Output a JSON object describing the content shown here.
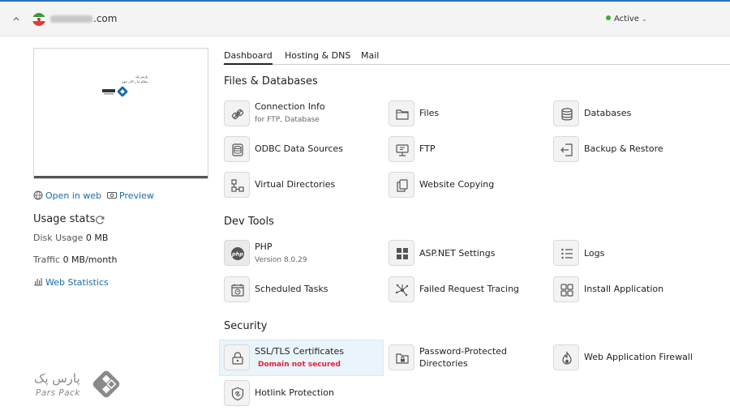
{
  "header": {
    "domain_suffix": ".com",
    "status": "Active",
    "status_color": "#3aab3a"
  },
  "preview": {
    "open_in_web": "Open in web",
    "preview": "Preview"
  },
  "usage": {
    "title": "Usage stats",
    "disk_label": "Disk Usage",
    "disk_value": "0 MB",
    "traffic_label": "Traffic",
    "traffic_value": "0 MB/month",
    "web_statistics": "Web Statistics"
  },
  "tabs": [
    "Dashboard",
    "Hosting & DNS",
    "Mail"
  ],
  "sections": {
    "files": {
      "title": "Files & Databases",
      "items": [
        {
          "label": "Connection Info",
          "sub": "for FTP, Database",
          "icon": "connection-icon"
        },
        {
          "label": "Files",
          "icon": "folder-icon"
        },
        {
          "label": "Databases",
          "icon": "database-icon"
        },
        {
          "label": "ODBC Data Sources",
          "icon": "odbc-icon"
        },
        {
          "label": "FTP",
          "icon": "ftp-icon"
        },
        {
          "label": "Backup & Restore",
          "icon": "backup-icon"
        },
        {
          "label": "Virtual Directories",
          "icon": "virtual-directories-icon"
        },
        {
          "label": "Website Copying",
          "icon": "copy-icon"
        }
      ]
    },
    "dev": {
      "title": "Dev Tools",
      "items": [
        {
          "label": "PHP",
          "sub": "Version 8.0.29",
          "icon": "php-icon"
        },
        {
          "label": "ASP.NET Settings",
          "icon": "aspnet-icon"
        },
        {
          "label": "Logs",
          "icon": "logs-icon"
        },
        {
          "label": "Scheduled Tasks",
          "icon": "scheduled-tasks-icon"
        },
        {
          "label": "Failed Request Tracing",
          "icon": "tracing-icon"
        },
        {
          "label": "Install Application",
          "icon": "install-app-icon"
        }
      ]
    },
    "security": {
      "title": "Security",
      "items": [
        {
          "label": "SSL/TLS Certificates",
          "warn": "Domain not secured",
          "icon": "ssl-lock-icon"
        },
        {
          "label": "Password-Protected",
          "label2": "Directories",
          "icon": "password-folder-icon"
        },
        {
          "label": "Web Application Firewall",
          "icon": "firewall-icon"
        },
        {
          "label": "Hotlink Protection",
          "icon": "hotlink-icon"
        }
      ]
    }
  },
  "brand": {
    "name": "Pars Pack",
    "name_fa": "پارس پک"
  },
  "thumbnail": {
    "line1": "پارس پک",
    "line2": "سلام ما ر الان جون"
  },
  "colors": {
    "link": "#1a6ba8",
    "warning": "#e0243a",
    "highlight": "#e9f4fb"
  }
}
